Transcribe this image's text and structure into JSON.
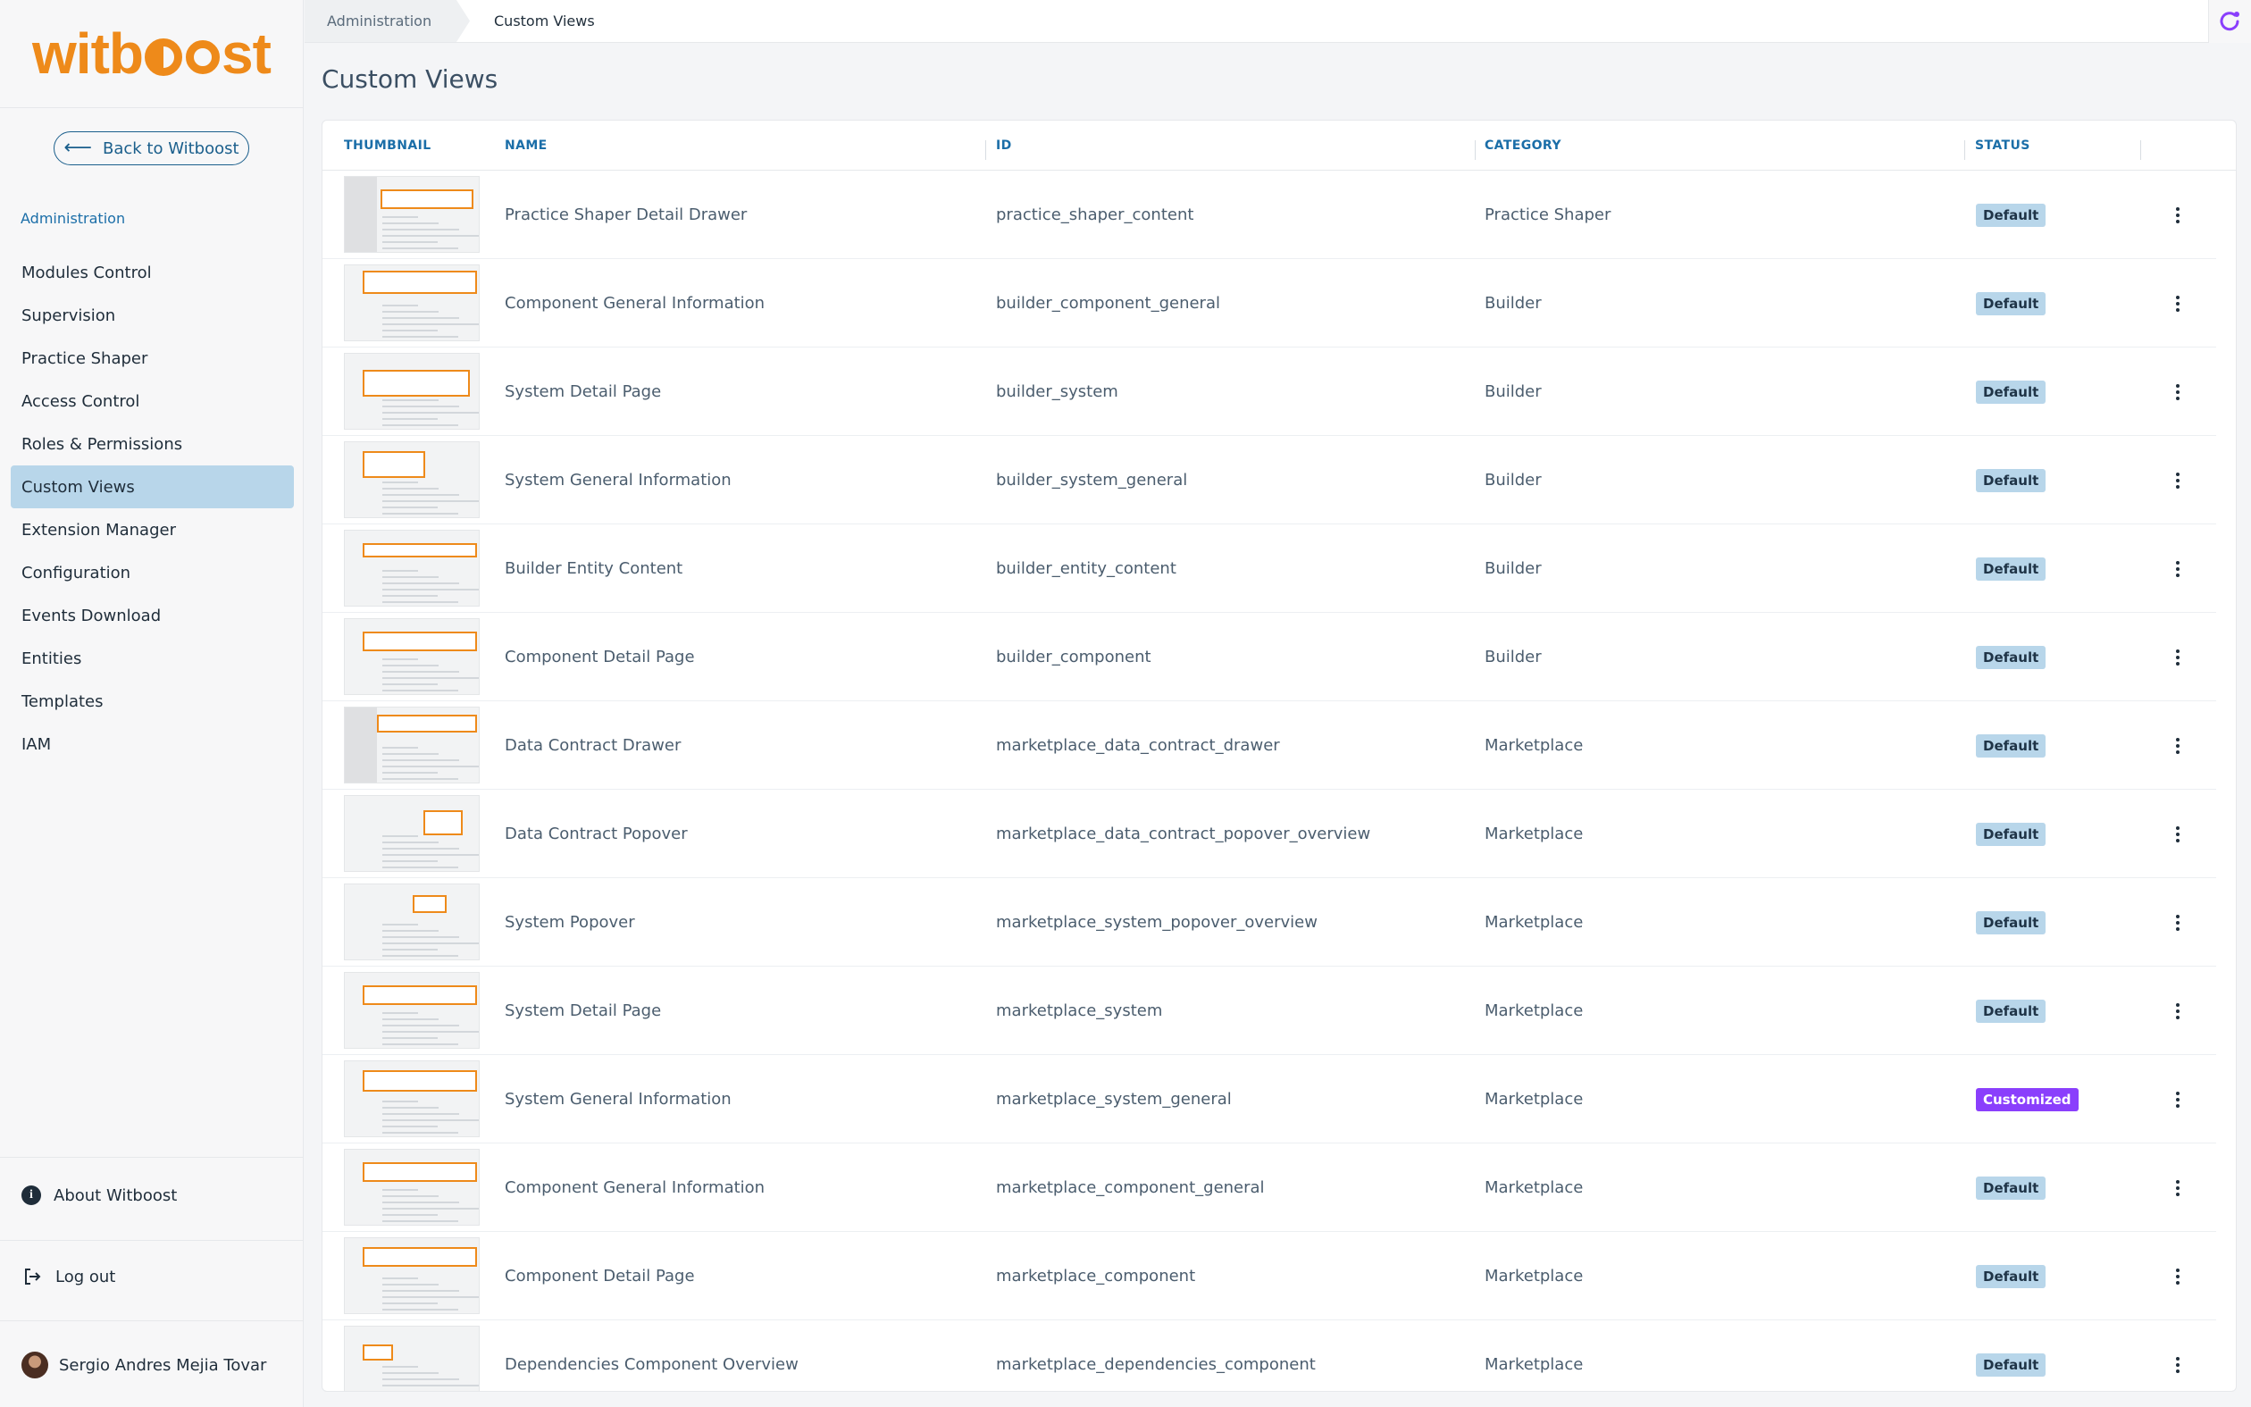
{
  "sidebar": {
    "logo_text": "witboost",
    "back_button": "Back to Witboost",
    "section_label": "Administration",
    "items": [
      {
        "label": "Modules Control",
        "active": false
      },
      {
        "label": "Supervision",
        "active": false
      },
      {
        "label": "Practice Shaper",
        "active": false
      },
      {
        "label": "Access Control",
        "active": false
      },
      {
        "label": "Roles & Permissions",
        "active": false
      },
      {
        "label": "Custom Views",
        "active": true
      },
      {
        "label": "Extension Manager",
        "active": false
      },
      {
        "label": "Configuration",
        "active": false
      },
      {
        "label": "Events Download",
        "active": false
      },
      {
        "label": "Entities",
        "active": false
      },
      {
        "label": "Templates",
        "active": false
      },
      {
        "label": "IAM",
        "active": false
      }
    ],
    "about": "About Witboost",
    "logout": "Log out",
    "user_name": "Sergio Andres Mejia Tovar"
  },
  "breadcrumb": [
    "Administration",
    "Custom Views"
  ],
  "page_title": "Custom Views",
  "table": {
    "columns": [
      "THUMBNAIL",
      "NAME",
      "ID",
      "CATEGORY",
      "STATUS"
    ],
    "rows": [
      {
        "name": "Practice Shaper Detail Drawer",
        "id": "practice_shaper_content",
        "category": "Practice Shaper",
        "status": "Default"
      },
      {
        "name": "Component General Information",
        "id": "builder_component_general",
        "category": "Builder",
        "status": "Default"
      },
      {
        "name": "System Detail Page",
        "id": "builder_system",
        "category": "Builder",
        "status": "Default"
      },
      {
        "name": "System General Information",
        "id": "builder_system_general",
        "category": "Builder",
        "status": "Default"
      },
      {
        "name": "Builder Entity Content",
        "id": "builder_entity_content",
        "category": "Builder",
        "status": "Default"
      },
      {
        "name": "Component Detail Page",
        "id": "builder_component",
        "category": "Builder",
        "status": "Default"
      },
      {
        "name": "Data Contract Drawer",
        "id": "marketplace_data_contract_drawer",
        "category": "Marketplace",
        "status": "Default"
      },
      {
        "name": "Data Contract Popover",
        "id": "marketplace_data_contract_popover_overview",
        "category": "Marketplace",
        "status": "Default"
      },
      {
        "name": "System Popover",
        "id": "marketplace_system_popover_overview",
        "category": "Marketplace",
        "status": "Default"
      },
      {
        "name": "System Detail Page",
        "id": "marketplace_system",
        "category": "Marketplace",
        "status": "Default"
      },
      {
        "name": "System General Information",
        "id": "marketplace_system_general",
        "category": "Marketplace",
        "status": "Customized"
      },
      {
        "name": "Component General Information",
        "id": "marketplace_component_general",
        "category": "Marketplace",
        "status": "Default"
      },
      {
        "name": "Component Detail Page",
        "id": "marketplace_component",
        "category": "Marketplace",
        "status": "Default"
      },
      {
        "name": "Dependencies Component Overview",
        "id": "marketplace_dependencies_component",
        "category": "Marketplace",
        "status": "Default"
      }
    ]
  },
  "colors": {
    "brand": "#ee8a1a",
    "accent": "#1b6ea8",
    "active_nav": "#b8d6ea",
    "customized_badge": "#8a3ffc"
  }
}
